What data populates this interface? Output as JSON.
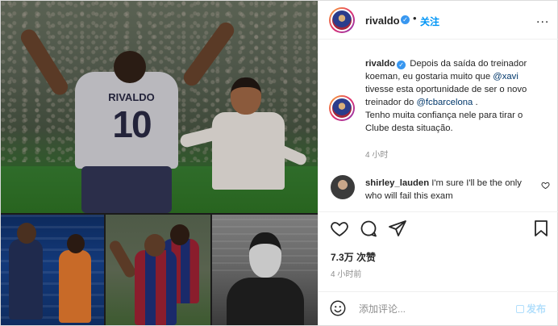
{
  "post": {
    "photos": {
      "top_jersey_name": "RIVALDO",
      "top_jersey_number": "10"
    },
    "header": {
      "username": "rivaldo",
      "verified_mark": "✓",
      "separator": "•",
      "follow_label": "关注",
      "more_label": "..."
    },
    "caption": {
      "username": "rivaldo",
      "text_1": "Depois da saída do treinador koeman, eu gostaria muito que ",
      "mention_1": "@xavi",
      "text_2": " tivesse esta oportunidade de ser o novo treinador do ",
      "mention_2": "@fcbarcelona",
      "text_3": " .",
      "text_4": "Tenho muita confiança nele para tirar o Clube desta situação.",
      "time": "4 小时"
    },
    "comment": {
      "username": "shirley_lauden",
      "text": "I'm sure I'll be the only who will fail this exam"
    },
    "stats": {
      "likes": "7.3万 次赞",
      "time": "4 小时前"
    },
    "add_comment": {
      "placeholder": "添加评论...",
      "post_label": "发布"
    },
    "colors": {
      "accent": "#0095f6",
      "verified": "#3897f0",
      "muted": "#8e8e8e",
      "post_disabled": "#b2dffc"
    }
  }
}
